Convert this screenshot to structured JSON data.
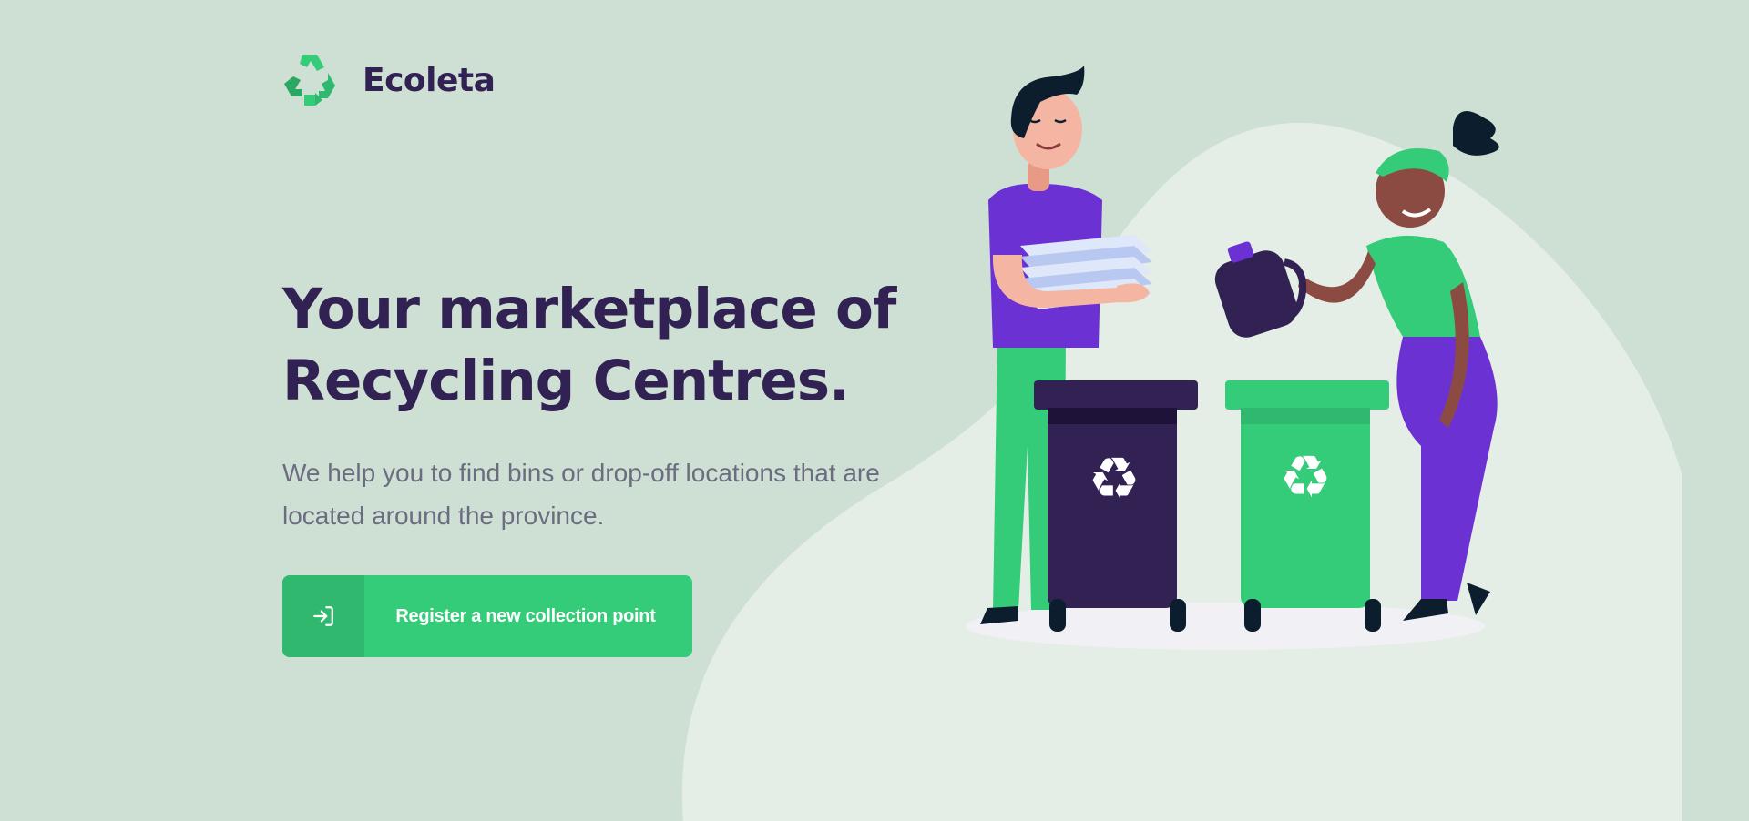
{
  "brand": {
    "name": "Ecoleta",
    "logo_icon": "recycle-icon"
  },
  "hero": {
    "title": "Your marketplace of Recycling Centres.",
    "description": "We help you to find bins or drop-off locations that are located around the province."
  },
  "cta": {
    "label": "Register a new collection point",
    "icon": "log-in-icon"
  },
  "colors": {
    "background": "#cee0d4",
    "title": "#322153",
    "text": "#6c6c80",
    "accent": "#34cb79",
    "accent_dark": "#2fb86e"
  }
}
